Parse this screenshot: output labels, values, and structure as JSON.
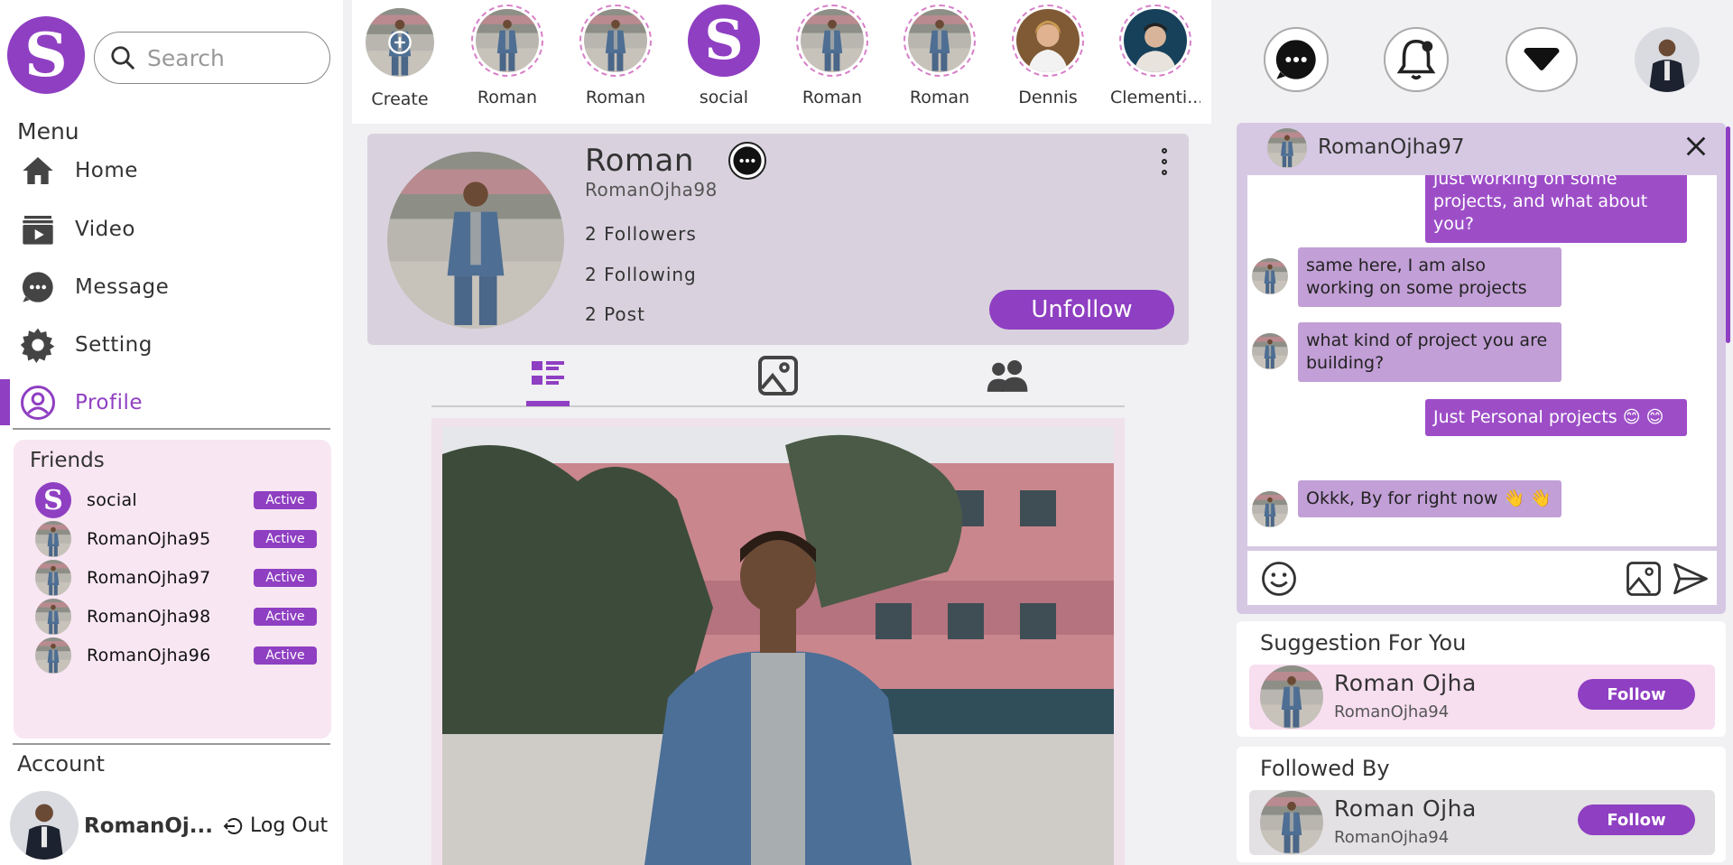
{
  "brand": {
    "logo_letter": "S",
    "accent": "#8f3fc2"
  },
  "search": {
    "placeholder": "Search"
  },
  "menu": {
    "title": "Menu",
    "items": [
      {
        "label": "Home",
        "icon": "home-icon"
      },
      {
        "label": "Video",
        "icon": "video-icon"
      },
      {
        "label": "Message",
        "icon": "message-icon"
      },
      {
        "label": "Setting",
        "icon": "gear-icon"
      },
      {
        "label": "Profile",
        "icon": "profile-icon",
        "active": true
      }
    ]
  },
  "friends": {
    "title": "Friends",
    "list": [
      {
        "name": "social",
        "status": "Active"
      },
      {
        "name": "RomanOjha95",
        "status": "Active"
      },
      {
        "name": "RomanOjha97",
        "status": "Active"
      },
      {
        "name": "RomanOjha98",
        "status": "Active"
      },
      {
        "name": "RomanOjha96",
        "status": "Active"
      }
    ]
  },
  "account": {
    "title": "Account",
    "name": "RomanOj...",
    "logout_label": "Log Out"
  },
  "stories": [
    {
      "label": "Create"
    },
    {
      "label": "Roman"
    },
    {
      "label": "Roman"
    },
    {
      "label": "social"
    },
    {
      "label": "Roman"
    },
    {
      "label": "Roman"
    },
    {
      "label": "Dennis"
    },
    {
      "label": "Clementi..."
    }
  ],
  "profile": {
    "name": "Roman",
    "username": "RomanOjha98",
    "followers": "2 Followers",
    "following": "2 Following",
    "posts": "2 Post",
    "unfollow_label": "Unfollow"
  },
  "chat": {
    "title": "RomanOjha97",
    "messages": [
      {
        "from": "me",
        "text": "just working on some projects, and what about you?"
      },
      {
        "from": "them",
        "text": "same here, I am also working on some projects"
      },
      {
        "from": "them",
        "text": "what kind of project you are building?"
      },
      {
        "from": "me",
        "text": "Just Personal projects 😊 😊"
      },
      {
        "from": "them",
        "text": "Okkk, By for right now 👋 👋"
      }
    ]
  },
  "suggestions": {
    "title": "Suggestion For You",
    "name": "Roman Ojha",
    "username": "RomanOjha94",
    "button": "Follow"
  },
  "followed_by": {
    "title": "Followed By",
    "name": "Roman Ojha",
    "username": "RomanOjha94",
    "button": "Follow"
  }
}
